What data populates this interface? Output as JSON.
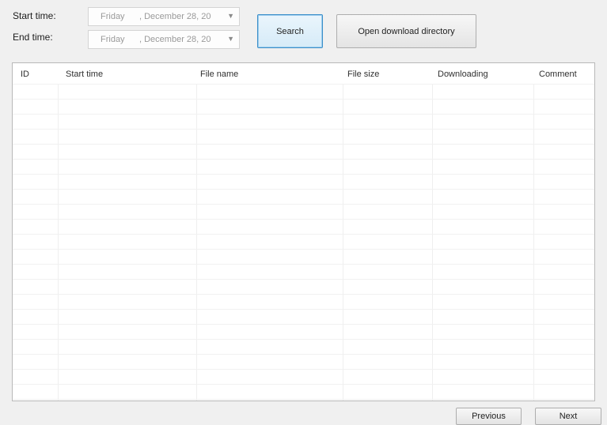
{
  "filters": {
    "start_label": "Start time:",
    "end_label": "End time:",
    "start_date": {
      "day": "Friday",
      "date": ", December 28, 20"
    },
    "end_date": {
      "day": "Friday",
      "date": ", December 28, 20"
    },
    "dropdown_icon": "chevron-down-icon"
  },
  "toolbar": {
    "search_label": "Search",
    "open_dir_label": "Open download directory"
  },
  "table": {
    "columns": [
      "ID",
      "Start time",
      "File name",
      "File size",
      "Downloading",
      "Comment"
    ],
    "rows": []
  },
  "pager": {
    "previous_label": "Previous",
    "next_label": "Next"
  }
}
